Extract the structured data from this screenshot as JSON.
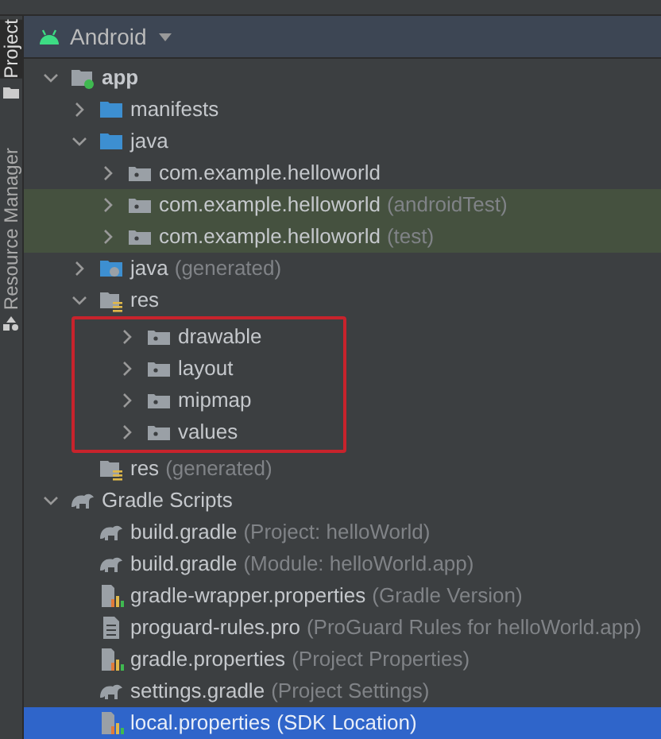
{
  "side_tabs": [
    {
      "label": "Project",
      "selected": true
    },
    {
      "label": "Resource Manager",
      "selected": false
    }
  ],
  "view_selector": {
    "label": "Android"
  },
  "tree": [
    {
      "label": "app",
      "kind": "module",
      "expanded": true,
      "children": [
        {
          "label": "manifests",
          "kind": "folder",
          "expanded": false
        },
        {
          "label": "java",
          "kind": "folder",
          "expanded": true,
          "children": [
            {
              "label": "com.example.helloworld",
              "kind": "package",
              "expanded": false,
              "tinted": false
            },
            {
              "label": "com.example.helloworld",
              "suffix": "(androidTest)",
              "kind": "package",
              "expanded": false,
              "tinted": true
            },
            {
              "label": "com.example.helloworld",
              "suffix": "(test)",
              "kind": "package",
              "expanded": false,
              "tinted": true
            }
          ]
        },
        {
          "label": "java",
          "suffix": "(generated)",
          "kind": "generated",
          "expanded": false
        },
        {
          "label": "res",
          "kind": "res",
          "expanded": true,
          "outlined": true,
          "children": [
            {
              "label": "drawable",
              "kind": "package",
              "expanded": false
            },
            {
              "label": "layout",
              "kind": "package",
              "expanded": false
            },
            {
              "label": "mipmap",
              "kind": "package",
              "expanded": false
            },
            {
              "label": "values",
              "kind": "package",
              "expanded": false
            }
          ]
        },
        {
          "label": "res",
          "suffix": "(generated)",
          "kind": "res"
        }
      ]
    },
    {
      "label": "Gradle Scripts",
      "kind": "gradle",
      "expanded": true,
      "children": [
        {
          "label": "build.gradle",
          "suffix": "(Project: helloWorld)",
          "kind": "gradle"
        },
        {
          "label": "build.gradle",
          "suffix": "(Module: helloWorld.app)",
          "kind": "gradle"
        },
        {
          "label": "gradle-wrapper.properties",
          "suffix": "(Gradle Version)",
          "kind": "properties"
        },
        {
          "label": "proguard-rules.pro",
          "suffix": "(ProGuard Rules for helloWorld.app)",
          "kind": "text"
        },
        {
          "label": "gradle.properties",
          "suffix": "(Project Properties)",
          "kind": "properties"
        },
        {
          "label": "settings.gradle",
          "suffix": "(Project Settings)",
          "kind": "gradle"
        },
        {
          "label": "local.properties",
          "suffix": "(SDK Location)",
          "kind": "properties",
          "selected": true
        }
      ]
    }
  ]
}
